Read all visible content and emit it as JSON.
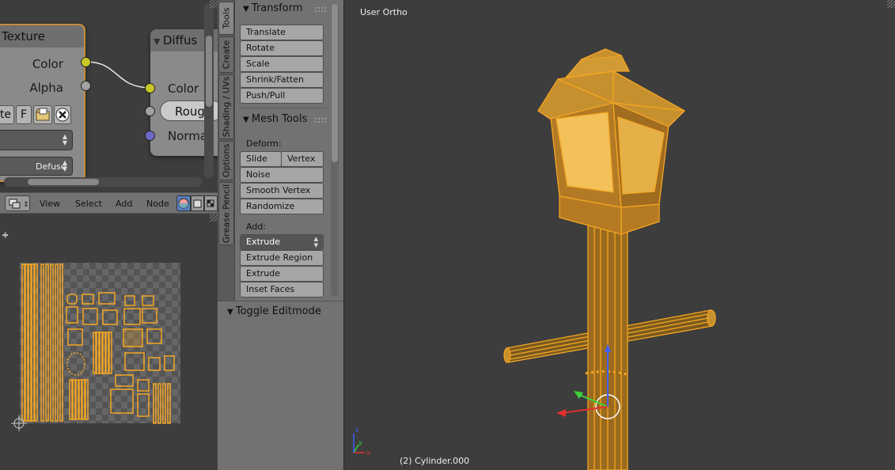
{
  "node_editor": {
    "texture_node": {
      "title": "Texture",
      "outputs": [
        "Color",
        "Alpha"
      ],
      "image_buttons": {
        "name_partial": "te",
        "fake_user": "F"
      },
      "color_space": "Defuse"
    },
    "diffuse_node": {
      "title": "Diffus",
      "inputs": [
        "Color",
        "Roug",
        "Norma"
      ]
    },
    "header_menu": [
      "View",
      "Select",
      "Add",
      "Node"
    ]
  },
  "tool_tabs": [
    "Tools",
    "Create",
    "Shading / UVs",
    "Options",
    "Grease Pencil"
  ],
  "tool_shelf": {
    "transform": {
      "title": "Transform",
      "buttons": [
        "Translate",
        "Rotate",
        "Scale",
        "Shrink/Fatten",
        "Push/Pull"
      ]
    },
    "mesh_tools": {
      "title": "Mesh Tools",
      "deform_label": "Deform:",
      "deform_row": [
        "Slide Ed",
        "Vertex"
      ],
      "deform_buttons": [
        "Noise",
        "Smooth Vertex",
        "Randomize"
      ],
      "add_label": "Add:",
      "extrude_select": "Extrude",
      "add_buttons": [
        "Extrude Region",
        "Extrude Individual",
        "Inset Faces"
      ]
    },
    "redo_panel_title": "Toggle Editmode"
  },
  "viewport": {
    "view_name": "User Ortho",
    "object_info": "(2) Cylinder.000"
  },
  "colors": {
    "selection_orange": "#f5a623",
    "lamp_glass": "#f2c15a",
    "socket_color": "#c7c729",
    "socket_vector": "#6b6bc7",
    "socket_grey": "#a1a1a1",
    "node_selected_border": "#c68a3a"
  }
}
